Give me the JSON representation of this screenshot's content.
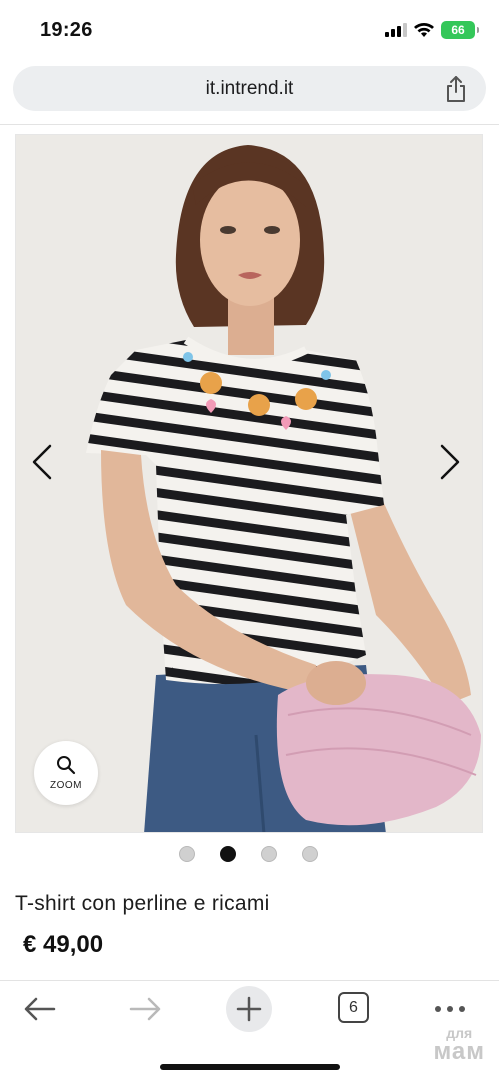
{
  "status_bar": {
    "time": "19:26",
    "battery": "66",
    "icons": [
      "cellular-signal-icon",
      "wifi-icon",
      "battery-charging-icon"
    ]
  },
  "browser": {
    "url": "it.intrend.it",
    "share_icon": "share-icon"
  },
  "carousel": {
    "prev_icon": "chevron-left-icon",
    "next_icon": "chevron-right-icon",
    "zoom_label": "ZOOM",
    "zoom_icon": "magnifier-icon",
    "slide_count": 4,
    "active_index": 1
  },
  "product": {
    "title": "T-shirt con perline e ricami",
    "price": "€ 49,00"
  },
  "toolbar": {
    "back_icon": "arrow-left-icon",
    "forward_icon": "arrow-right-icon",
    "new_tab_icon": "plus-icon",
    "tab_count": "6",
    "more_icon": "ellipsis-icon"
  },
  "watermark": {
    "top": "для",
    "bottom": "мам"
  },
  "colors": {
    "battery": "#34c759",
    "url_bar": "#eceef0",
    "background": "#ffffff"
  }
}
